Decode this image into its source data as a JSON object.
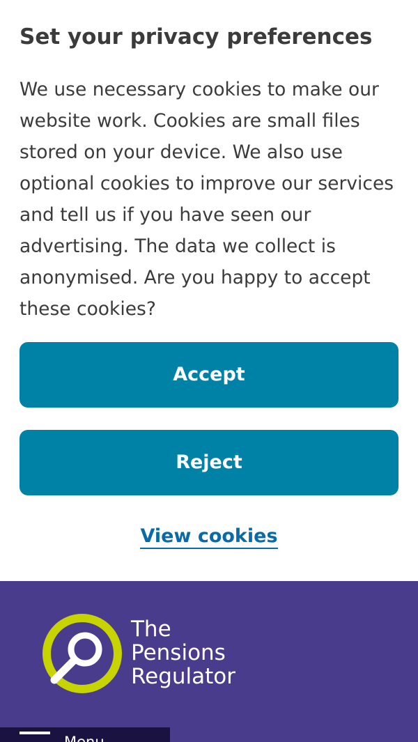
{
  "cookie_banner": {
    "title": "Set your privacy preferences",
    "body": "We use necessary cookies to make our website work. Cookies are small files stored on your device. We also use optional cookies to improve our services and tell us if you have seen our advertising. The data we collect is anonymised. Are you happy to accept these cookies?",
    "accept_label": "Accept",
    "reject_label": "Reject",
    "view_cookies_label": "View cookies"
  },
  "header": {
    "logo": {
      "line1": "The",
      "line2": "Pensions",
      "line3": "Regulator"
    },
    "menu_label": "Menu",
    "menu_icon": "hamburger-icon"
  },
  "colors": {
    "button_bg": "#0082a6",
    "link": "#0a6aa8",
    "header_bg": "#4a3c8c",
    "logo_ring": "#c8d400",
    "text": "#3b3b3b"
  }
}
